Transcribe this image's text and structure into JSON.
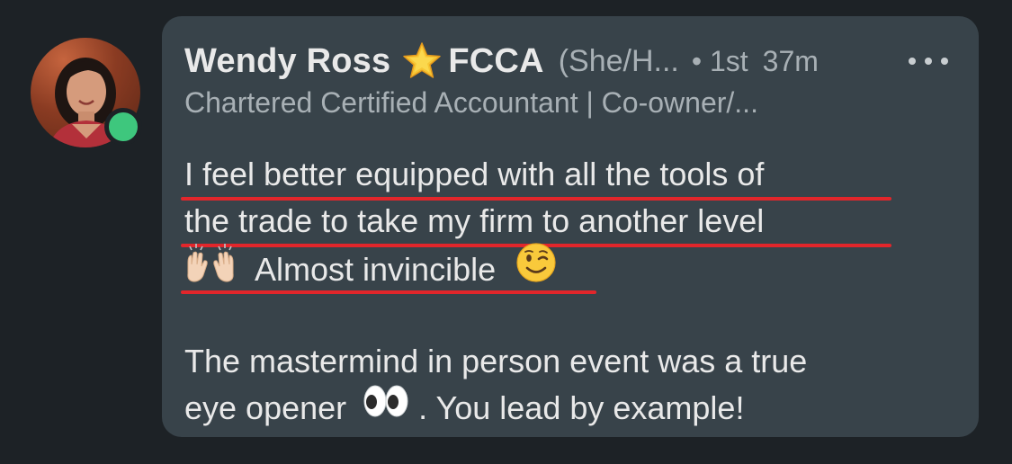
{
  "comment": {
    "author": {
      "name": "Wendy Ross",
      "credential": "FCCA",
      "pronouns": "(She/H...",
      "degree": "• 1st",
      "time": "37m",
      "headline": "Chartered Certified Accountant | Co-owner/...",
      "online_status_color": "#3ec77d"
    },
    "message": {
      "line1": "I feel better equipped with all the tools of",
      "line2": "the trade to take my firm to another level",
      "line3": "Almost invincible",
      "line4": "The mastermind in person event was a true",
      "line5a": "eye opener",
      "line5b": ". You lead by example!"
    },
    "icons": [
      "star-icon",
      "raised-hands-icon",
      "winking-face-icon",
      "eyes-icon",
      "more-options-icon"
    ],
    "colors": {
      "background": "#1d2226",
      "bubble": "#38434a",
      "highlight_underline": "#e2262b"
    }
  }
}
